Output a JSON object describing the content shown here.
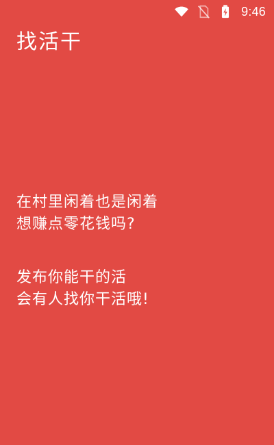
{
  "status_bar": {
    "time": "9:46",
    "icons": [
      "wifi-icon",
      "sim-off-icon",
      "battery-charging-icon"
    ]
  },
  "app": {
    "title": "找活干"
  },
  "promo": {
    "group1": [
      "在村里闲着也是闲着",
      "想赚点零花钱吗?"
    ],
    "group2": [
      "发布你能干的活",
      "会有人找你干活哦!"
    ]
  },
  "colors": {
    "background": "#e24a44",
    "text": "#ffffff"
  }
}
